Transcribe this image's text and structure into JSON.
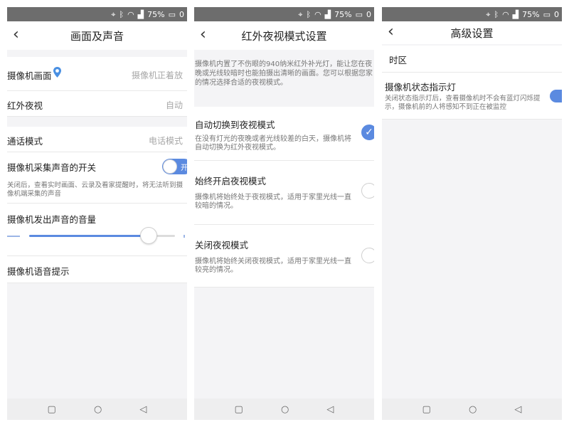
{
  "status": {
    "battery": "75%",
    "battery_cut": "0",
    "icons": [
      "location-icon",
      "bluetooth-icon",
      "wifi-icon",
      "signal-icon",
      "battery-icon"
    ]
  },
  "screen1": {
    "title": "画面及声音",
    "camera_picture": {
      "label": "摄像机画面",
      "value": "摄像机正着放"
    },
    "night_vision": {
      "label": "红外夜视",
      "value": "自动"
    },
    "call_mode": {
      "label": "通话模式",
      "value": "电话模式"
    },
    "audio_switch": {
      "label": "摄像机采集声音的开关",
      "toggle_text": "开",
      "on": true,
      "desc": "关闭后，查看实时画面、云录及看家提醒时，将无法听到摄像机端采集的声音"
    },
    "volume": {
      "label": "摄像机发出声音的音量",
      "level": 0.82
    },
    "voice_prompt": {
      "label": "摄像机语音提示"
    }
  },
  "screen2": {
    "title": "红外夜视模式设置",
    "intro": "摄像机内置了不伤眼的940纳米红外补光灯，能让您在夜晚或光线较暗时也能拍摄出清晰的画面。您可以根据您家的情况选择合适的夜视模式。",
    "options": [
      {
        "title": "自动切换到夜视模式",
        "desc": "在没有灯光的夜晚或者光线较差的白天，摄像机将自动切换为红外夜视模式。",
        "selected": true
      },
      {
        "title": "始终开启夜视模式",
        "desc": "摄像机将始终处于夜视模式，适用于家里光线一直较暗的情况。",
        "selected": false
      },
      {
        "title": "关闭夜视模式",
        "desc": "摄像机将始终关闭夜视模式，适用于家里光线一直较亮的情况。",
        "selected": false
      }
    ]
  },
  "screen3": {
    "title": "高级设置",
    "timezone": {
      "label": "时区"
    },
    "indicator": {
      "label": "摄像机状态指示灯",
      "on": true,
      "desc": "关闭状态指示灯后，查看摄像机时不会有蓝灯闪烁提示，摄像机前的人将感知不到正在被监控"
    }
  },
  "icons": {
    "back": "back-arrow-icon",
    "location_pin": "location-pin-icon",
    "check": "check-icon",
    "nav_square": "recent-apps-icon",
    "nav_circle": "home-icon",
    "nav_triangle": "back-triangle-icon"
  },
  "colors": {
    "accent": "#5b8ae0",
    "statusbar": "#6d6d6d",
    "background": "#f4f4f6"
  }
}
